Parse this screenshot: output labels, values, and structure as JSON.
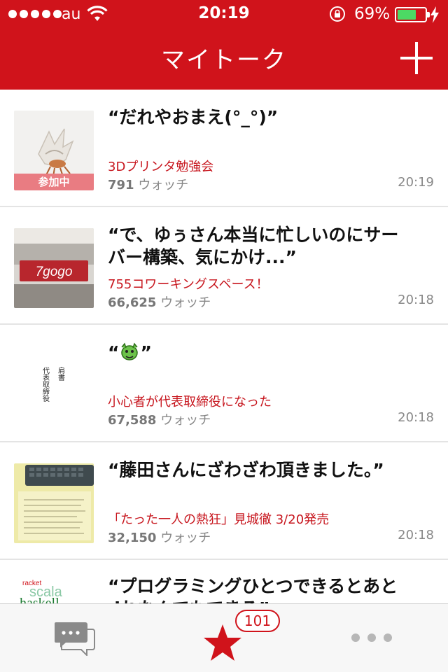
{
  "status_bar": {
    "carrier": "au",
    "time": "20:19",
    "battery_percent": "69%",
    "battery_level": 0.69,
    "icons": [
      "signal-dots-icon",
      "wifi-icon",
      "rotation-lock-icon",
      "battery-icon",
      "charging-bolt-icon"
    ]
  },
  "nav": {
    "title": "マイトーク",
    "add_icon": "plus-icon"
  },
  "talks": [
    {
      "title": "“だれやおまえ(°_°)”",
      "group": "3Dプリンタ勉強会",
      "watch_count": "791",
      "watch_label": "ウォッチ",
      "time": "20:19",
      "joined_badge": "参加中"
    },
    {
      "title": "“で、ゆぅさん本当に忙しいのにサーバー構築、気にかけ...”",
      "group": "755コワーキングスペース！",
      "watch_count": "66,625",
      "watch_label": "ウォッチ",
      "time": "20:18",
      "thumb_text": "7gogo"
    },
    {
      "title": "“”",
      "group": "小心者が代表取締役になった",
      "watch_count": "67,588",
      "watch_label": "ウォッチ",
      "time": "20:18",
      "thumb_text_a": "肩書",
      "thumb_text_b": "代表取締役"
    },
    {
      "title": "“藤田さんにざわざわ頂きました。”",
      "group": "「たった一人の熱狂」見城徹 3/20発売",
      "watch_count": "32,150",
      "watch_label": "ウォッチ",
      "time": "20:18"
    },
    {
      "title": "“プログラミングひとつできるとあと dれなんでもできる”",
      "thumb_words": [
        "racket",
        "scala",
        "haskell"
      ]
    }
  ],
  "tabbar": {
    "talk_icon": "chat-bubbles-icon",
    "favorites_icon": "star-icon",
    "favorites_badge": "101",
    "more_icon": "more-dots-icon"
  },
  "colors": {
    "brand_red": "#d0131b",
    "group_red": "#c7161e",
    "joined_pink": "#e97c82",
    "battery_green": "#4cd964"
  }
}
